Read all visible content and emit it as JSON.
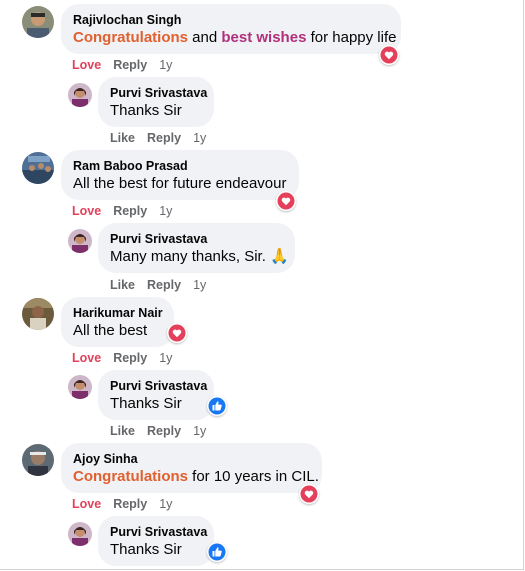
{
  "comments": [
    {
      "author": "Rajivlochan Singh",
      "text_parts": [
        {
          "t": "Congratulations",
          "style": "orange"
        },
        {
          "t": " and ",
          "style": "plain"
        },
        {
          "t": "best wishes",
          "style": "purple"
        },
        {
          "t": " for happy life",
          "style": "plain"
        }
      ],
      "actions": {
        "react": "Love",
        "reply": "Reply",
        "time": "1y"
      },
      "reaction": "love-reaction-icon",
      "reply": {
        "author": "Purvi Srivastava",
        "text": "Thanks Sir",
        "actions": {
          "react": "Like",
          "reply": "Reply",
          "time": "1y"
        },
        "reaction": ""
      }
    },
    {
      "author": "Ram Baboo Prasad",
      "text_parts": [
        {
          "t": "All the best for future endeavour",
          "style": "plain"
        }
      ],
      "actions": {
        "react": "Love",
        "reply": "Reply",
        "time": "1y"
      },
      "reaction": "love-reaction-icon",
      "reply": {
        "author": "Purvi Srivastava",
        "text": "Many many thanks, Sir. 🙏",
        "actions": {
          "react": "Like",
          "reply": "Reply",
          "time": "1y"
        },
        "reaction": ""
      }
    },
    {
      "author": "Harikumar Nair",
      "text_parts": [
        {
          "t": "All the best",
          "style": "plain"
        }
      ],
      "actions": {
        "react": "Love",
        "reply": "Reply",
        "time": "1y"
      },
      "reaction": "love-reaction-icon",
      "reply": {
        "author": "Purvi Srivastava",
        "text": "Thanks Sir",
        "actions": {
          "react": "Like",
          "reply": "Reply",
          "time": "1y"
        },
        "reaction": "like-reaction-icon"
      }
    },
    {
      "author": "Ajoy Sinha",
      "text_parts": [
        {
          "t": "Congratulations",
          "style": "orange"
        },
        {
          "t": " for 10 years in CIL.",
          "style": "plain"
        }
      ],
      "actions": {
        "react": "Love",
        "reply": "Reply",
        "time": "1y"
      },
      "reaction": "love-reaction-icon",
      "reply": {
        "author": "Purvi Srivastava",
        "text": "Thanks Sir",
        "actions": {
          "react": "Like",
          "reply": "Reply",
          "time": "1y"
        },
        "reaction": "like-reaction-icon"
      }
    }
  ],
  "colors": {
    "bubble": "#f0f2f5",
    "love": "#e4405b",
    "like": "#1877f2",
    "highlight_orange": "#e0602f",
    "highlight_purple": "#b0307c",
    "meta": "#65676b"
  }
}
